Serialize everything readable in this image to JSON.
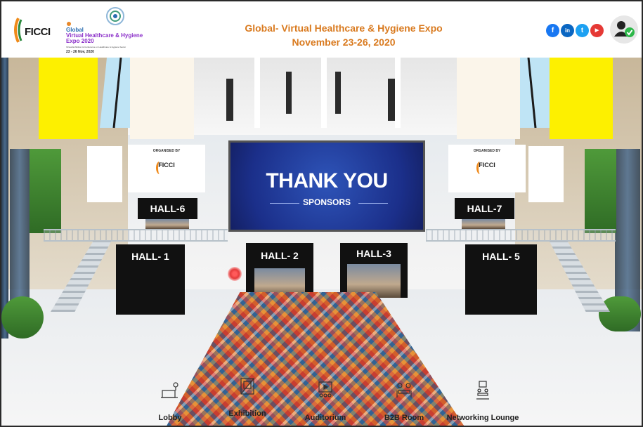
{
  "header": {
    "ficci_logo_text": "FICCI",
    "expo_logo": {
      "line1": "Global",
      "line2": "Virtual Healthcare & Hygiene",
      "line3": "Expo 2020",
      "line4": "Virtual Exhibition & Conference on Healthcare & Hygiene Sector",
      "line5": "23 - 26 Nov, 2020"
    },
    "title": "Global- Virtual Healthcare & Hygiene Expo",
    "subtitle": "November 23-26, 2020",
    "social": [
      {
        "name": "facebook-icon",
        "glyph": "f",
        "color": "#1877f2"
      },
      {
        "name": "linkedin-icon",
        "glyph": "in",
        "color": "#0a66c2"
      },
      {
        "name": "twitter-icon",
        "glyph": "t",
        "color": "#1da1f2"
      },
      {
        "name": "youtube-icon",
        "glyph": "▶",
        "color": "#e53935"
      }
    ]
  },
  "scene": {
    "screen_title": "THANK YOU",
    "screen_subtitle": "SPONSORS",
    "organised_label": "ORGANISED BY",
    "organiser_name": "FICCI",
    "halls": [
      "HALL-6",
      "HALL- 1",
      "HALL- 2",
      "HALL-3",
      "HALL-7",
      "HALL- 5"
    ]
  },
  "nav": [
    {
      "label": "Lobby",
      "icon": "lobby-icon"
    },
    {
      "label": "Exhibition",
      "icon": "exhibition-icon"
    },
    {
      "label": "Auditorium",
      "icon": "auditorium-icon"
    },
    {
      "label": "B2B Room",
      "icon": "b2b-room-icon"
    },
    {
      "label": "Networking Lounge",
      "icon": "networking-lounge-icon"
    }
  ],
  "colors": {
    "title": "#d97a1f",
    "banner_yellow": "#fdf000",
    "screen_blue": "#1b2f8a",
    "online_badge": "#2eb84a"
  }
}
